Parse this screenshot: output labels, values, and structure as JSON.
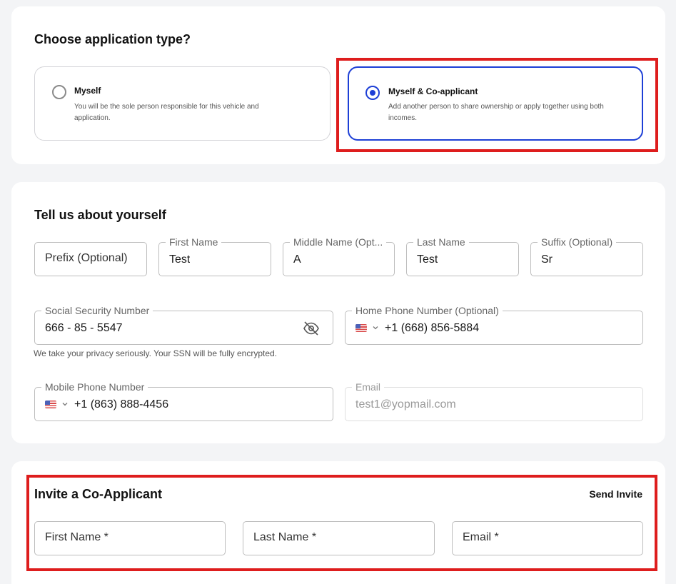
{
  "application_type": {
    "title": "Choose application type?",
    "options": [
      {
        "title": "Myself",
        "description": "You will be the sole person responsible for this vehicle and application.",
        "selected": false
      },
      {
        "title": "Myself & Co-applicant",
        "description": "Add another person to share ownership or apply together using both incomes.",
        "selected": true
      }
    ]
  },
  "about_you": {
    "title": "Tell us about yourself",
    "prefix": {
      "placeholder": "Prefix (Optional)"
    },
    "first_name": {
      "label": "First Name",
      "value": "Test"
    },
    "middle_name": {
      "label": "Middle Name (Opt...",
      "value": "A"
    },
    "last_name": {
      "label": "Last Name",
      "value": "Test"
    },
    "suffix": {
      "label": "Suffix (Optional)",
      "value": "Sr"
    },
    "ssn": {
      "label": "Social Security Number",
      "value": "666 - 85 - 5547",
      "hint": "We take your privacy seriously. Your SSN will be fully encrypted.",
      "toggle_icon": "eye-off-icon"
    },
    "home_phone": {
      "label": "Home Phone Number (Optional)",
      "value": "+1 (668) 856-5884",
      "country_icon": "us-flag-icon"
    },
    "mobile_phone": {
      "label": "Mobile Phone Number",
      "value": "+1 (863) 888-4456",
      "country_icon": "us-flag-icon"
    },
    "email": {
      "label": "Email",
      "value": "test1@yopmail.com",
      "disabled": true
    }
  },
  "co_applicant": {
    "title": "Invite a Co-Applicant",
    "send_invite": "Send Invite",
    "first_name": {
      "placeholder": "First Name *"
    },
    "last_name": {
      "placeholder": "Last Name *"
    },
    "email": {
      "placeholder": "Email *"
    }
  },
  "colors": {
    "accent": "#1d3fd6",
    "highlight": "#de1d1d",
    "background": "#f3f4f6"
  }
}
